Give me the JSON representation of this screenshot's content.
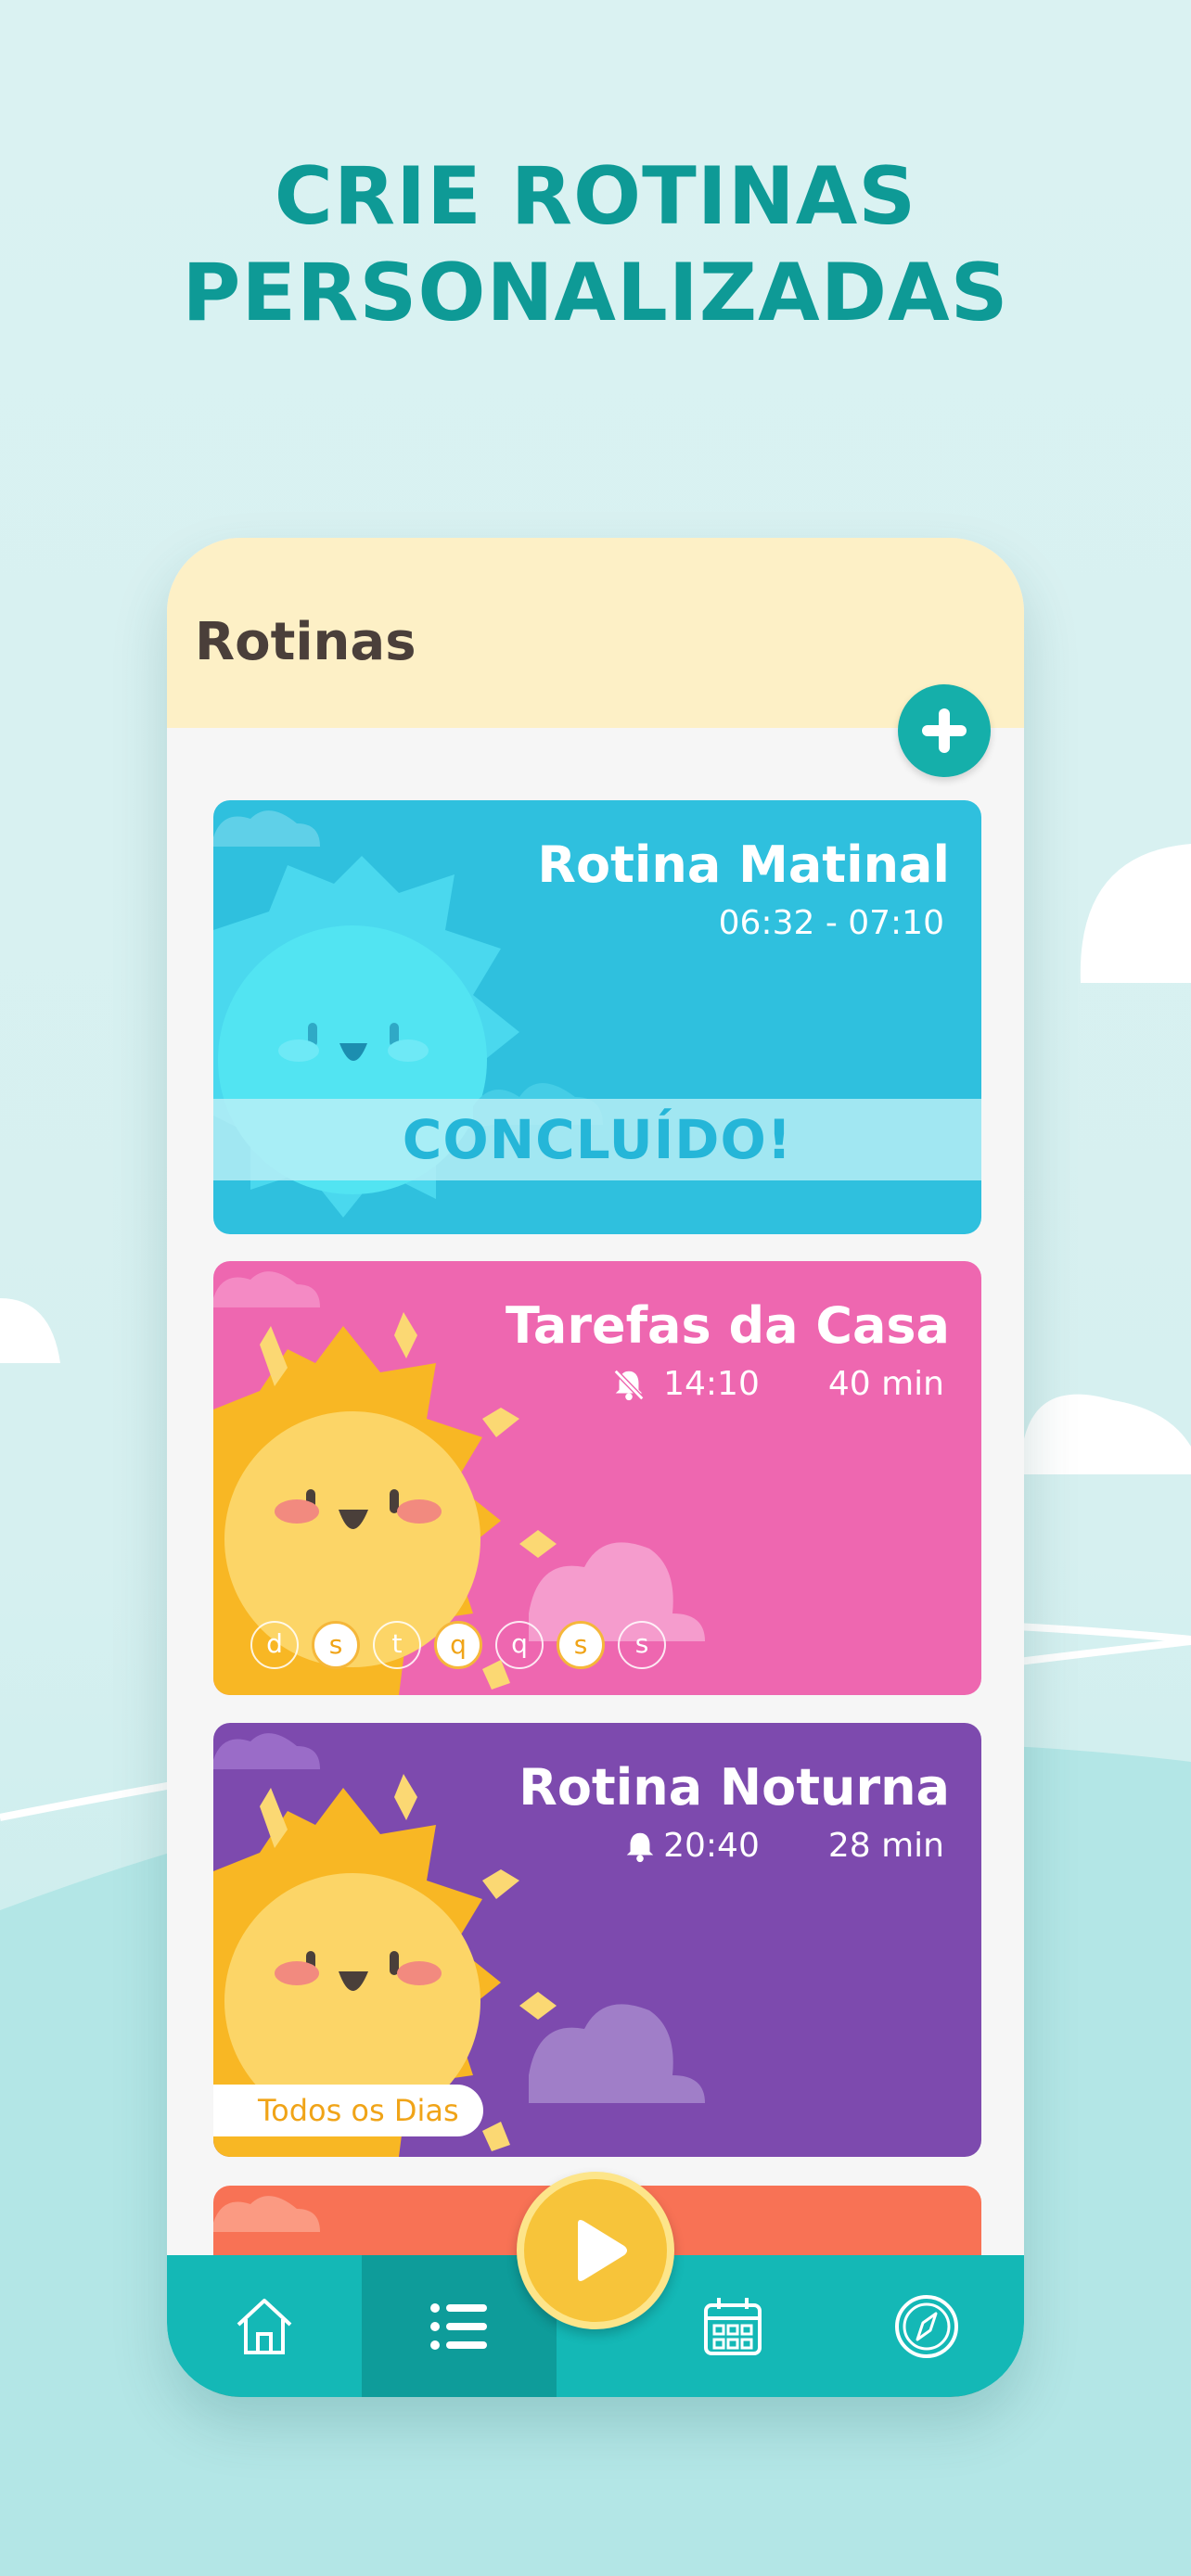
{
  "headline": {
    "line1": "CRIE ROTINAS",
    "line2": "PERSONALIZADAS"
  },
  "screen": {
    "title": "Rotinas",
    "add_icon": "plus-icon",
    "routines": [
      {
        "name": "Rotina Matinal",
        "time": "06:32 - 07:10",
        "status": "CONCLUÍDO!",
        "color": "#2fc0de"
      },
      {
        "name": "Tarefas da Casa",
        "time": "14:10",
        "duration": "40 min",
        "alarm_icon": "bell-off-icon",
        "color": "#ee67b0",
        "days": [
          "d",
          "s",
          "t",
          "q",
          "q",
          "s",
          "s"
        ],
        "days_active": [
          false,
          true,
          false,
          true,
          false,
          true,
          false
        ]
      },
      {
        "name": "Rotina Noturna",
        "time": "20:40",
        "duration": "28 min",
        "alarm_icon": "bell-icon",
        "color": "#7d4aae",
        "repeat": "Todos os Dias"
      },
      {
        "color": "#f87255"
      }
    ]
  },
  "nav": {
    "items": [
      {
        "icon": "home-icon",
        "active": false
      },
      {
        "icon": "list-icon",
        "active": true
      },
      {
        "icon": "calendar-icon",
        "active": false
      },
      {
        "icon": "compass-icon",
        "active": false
      }
    ],
    "play_icon": "play-icon"
  }
}
